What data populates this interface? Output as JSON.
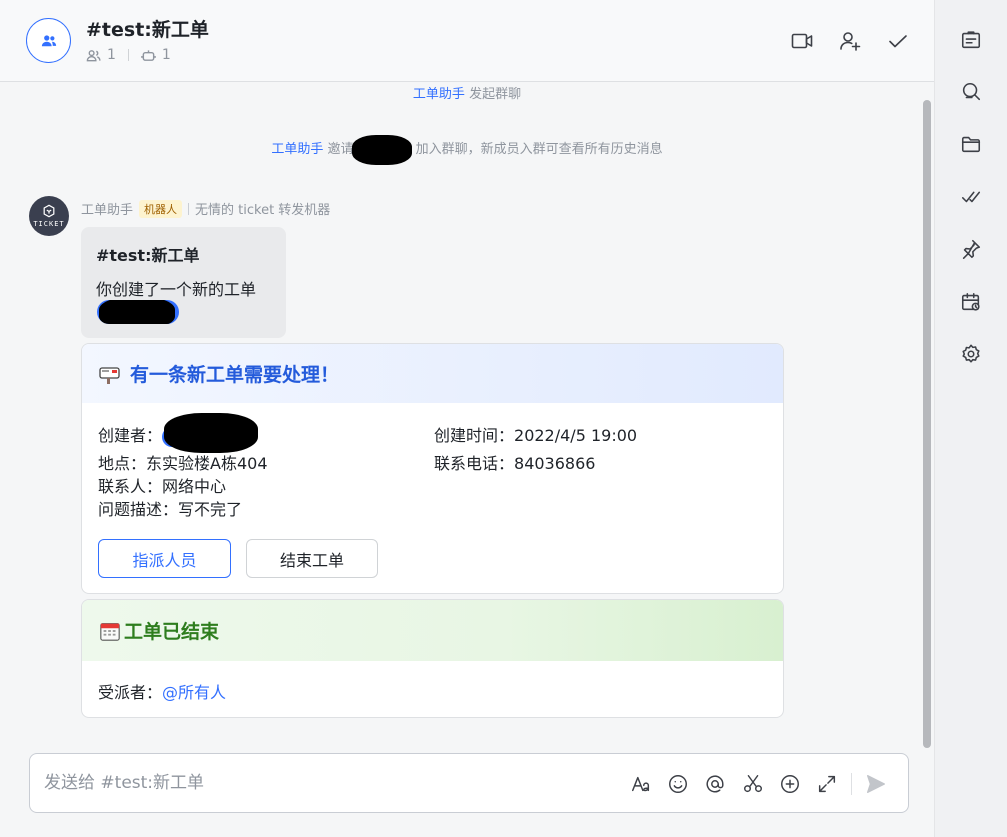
{
  "header": {
    "title": "#test:新工单",
    "member_count": "1",
    "bot_count": "1"
  },
  "system_messages": {
    "line1_actor": "工单助手",
    "line1_text": "发起群聊",
    "line2_actor": "工单助手",
    "line2_prefix": "邀请",
    "line2_suffix": "加入群聊，新成员入群可查看所有历史消息"
  },
  "message": {
    "sender": "工单助手",
    "badge": "机器人",
    "sender_desc": "无情的 ticket 转发机器",
    "avatar_text": "TICKET",
    "bubble_title": "#test:新工单",
    "bubble_text": "你创建了一个新的工单"
  },
  "card_new": {
    "title": "有一条新工单需要处理！",
    "creator_label": "创建者：",
    "created_time_label": "创建时间：",
    "created_time": "2022/4/5 19:00",
    "location_label": "地点：",
    "location": "东实验楼A栋404",
    "phone_label": "联系电话：",
    "phone": "84036866",
    "contact_label": "联系人：",
    "contact": "网络中心",
    "desc_label": "问题描述：",
    "desc": "写不完了",
    "assign_button": "指派人员",
    "close_button": "结束工单"
  },
  "card_closed": {
    "title": "工单已结束",
    "assignee_label": "受派者：",
    "assignee": "@所有人"
  },
  "composer": {
    "placeholder": "发送给 #test:新工单"
  },
  "colors": {
    "accent": "#3370ff",
    "green_title": "#2e7d1e",
    "blue_title": "#245bdb"
  }
}
